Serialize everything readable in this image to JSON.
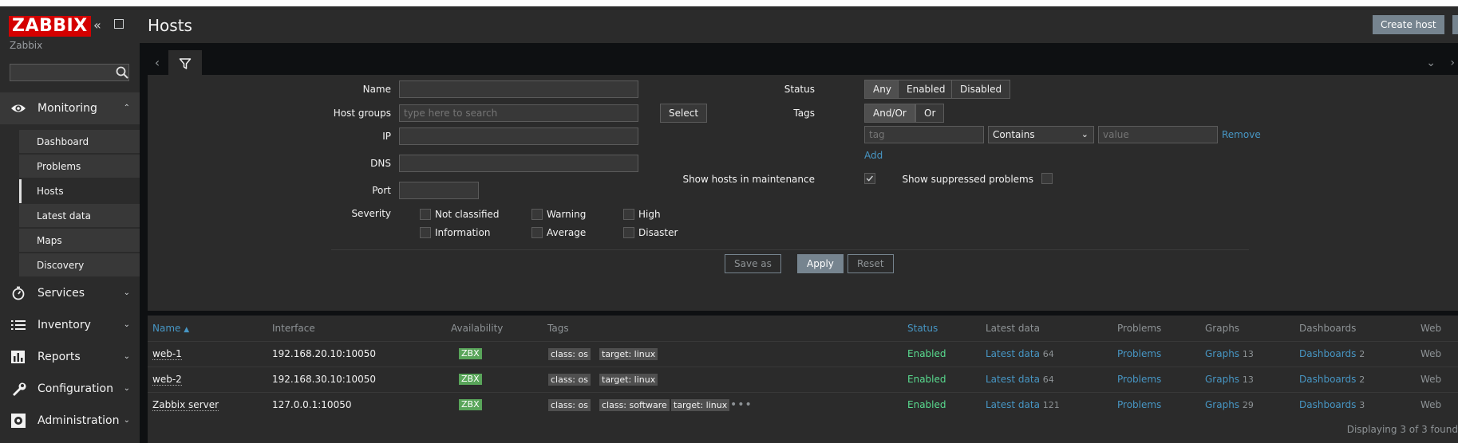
{
  "sidebar": {
    "logo": "ZABBIX",
    "subtitle": "Zabbix",
    "search_placeholder": "",
    "menu": [
      {
        "label": "Monitoring",
        "icon": "eye-icon",
        "expanded": true,
        "items": [
          "Dashboard",
          "Problems",
          "Hosts",
          "Latest data",
          "Maps",
          "Discovery"
        ],
        "active_item": "Hosts"
      },
      {
        "label": "Services",
        "icon": "stopwatch-icon"
      },
      {
        "label": "Inventory",
        "icon": "list-icon"
      },
      {
        "label": "Reports",
        "icon": "bar-chart-icon"
      },
      {
        "label": "Configuration",
        "icon": "wrench-icon"
      },
      {
        "label": "Administration",
        "icon": "gear-icon"
      }
    ]
  },
  "header": {
    "title": "Hosts",
    "create_button": "Create host"
  },
  "filter": {
    "name_label": "Name",
    "name_value": "",
    "host_groups_label": "Host groups",
    "host_groups_placeholder": "type here to search",
    "select_button": "Select",
    "ip_label": "IP",
    "dns_label": "DNS",
    "port_label": "Port",
    "severity_label": "Severity",
    "severities": [
      "Not classified",
      "Warning",
      "High",
      "Information",
      "Average",
      "Disaster"
    ],
    "status_label": "Status",
    "status_options": [
      "Any",
      "Enabled",
      "Disabled"
    ],
    "status_selected": "Any",
    "tags_label": "Tags",
    "tags_options": [
      "And/Or",
      "Or"
    ],
    "tags_selected": "And/Or",
    "tag_placeholder": "tag",
    "tag_operator": "Contains",
    "tag_value_placeholder": "value",
    "remove_link": "Remove",
    "add_link": "Add",
    "maintenance_label": "Show hosts in maintenance",
    "maintenance_checked": true,
    "suppressed_label": "Show suppressed problems",
    "suppressed_checked": false,
    "save_as": "Save as",
    "apply": "Apply",
    "reset": "Reset"
  },
  "table": {
    "columns": [
      "Name",
      "Interface",
      "Availability",
      "Tags",
      "Status",
      "Latest data",
      "Problems",
      "Graphs",
      "Dashboards",
      "Web"
    ],
    "sort_indicator": "▲",
    "rows": [
      {
        "name": "web-1",
        "interface": "192.168.20.10:10050",
        "availability": "ZBX",
        "tags": [
          "class: os",
          "target: linux"
        ],
        "more_tags": false,
        "status": "Enabled",
        "latest_data": "Latest data",
        "latest_count": "64",
        "problems": "Problems",
        "graphs": "Graphs",
        "graphs_count": "13",
        "dashboards": "Dashboards",
        "dashboards_count": "2",
        "web": "Web"
      },
      {
        "name": "web-2",
        "interface": "192.168.30.10:10050",
        "availability": "ZBX",
        "tags": [
          "class: os",
          "target: linux"
        ],
        "more_tags": false,
        "status": "Enabled",
        "latest_data": "Latest data",
        "latest_count": "64",
        "problems": "Problems",
        "graphs": "Graphs",
        "graphs_count": "13",
        "dashboards": "Dashboards",
        "dashboards_count": "2",
        "web": "Web"
      },
      {
        "name": "Zabbix server",
        "interface": "127.0.0.1:10050",
        "availability": "ZBX",
        "tags": [
          "class: os",
          "class: software",
          "target: linux"
        ],
        "more_tags": true,
        "status": "Enabled",
        "latest_data": "Latest data",
        "latest_count": "121",
        "problems": "Problems",
        "graphs": "Graphs",
        "graphs_count": "29",
        "dashboards": "Dashboards",
        "dashboards_count": "3",
        "web": "Web"
      }
    ],
    "footer": "Displaying 3 of 3 found"
  }
}
